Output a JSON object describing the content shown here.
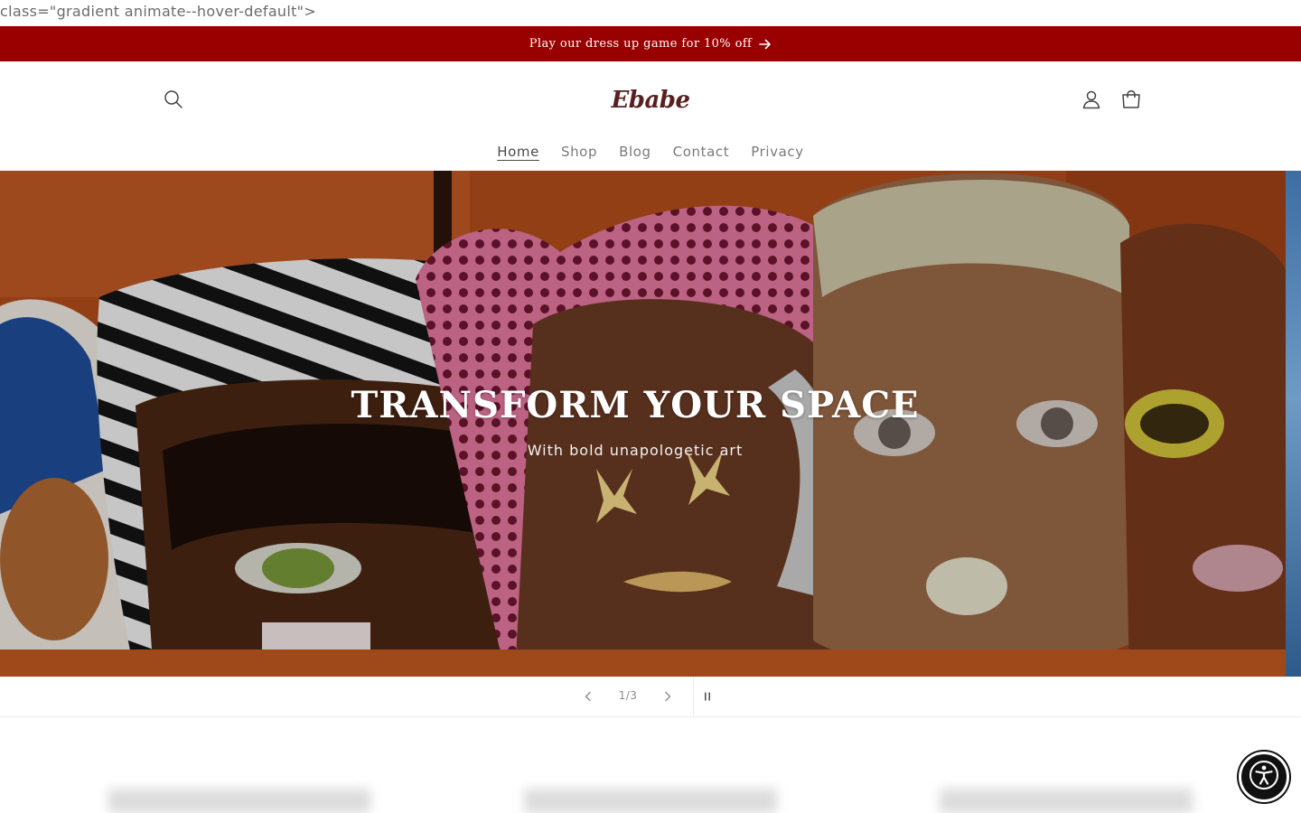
{
  "stray_text": "class=\"gradient animate--hover-default\">",
  "announcement": {
    "text": "Play our dress up game for 10% off",
    "bg_color": "#990000",
    "arrow_icon": "arrow-right-icon"
  },
  "header": {
    "logo_text": "Ebabe",
    "icons": {
      "search": "search-icon",
      "account": "account-icon",
      "cart": "cart-icon"
    }
  },
  "nav": {
    "items": [
      {
        "label": "Home",
        "active": true
      },
      {
        "label": "Shop",
        "active": false
      },
      {
        "label": "Blog",
        "active": false
      },
      {
        "label": "Contact",
        "active": false
      },
      {
        "label": "Privacy",
        "active": false
      }
    ]
  },
  "hero": {
    "title": "TRANSFORM YOUR SPACE",
    "subtitle": "With bold unapologetic art",
    "accent_color": "#b8501e"
  },
  "slider": {
    "counter": "1/3",
    "current": 1,
    "total": 3,
    "prev_icon": "chevron-left-icon",
    "next_icon": "chevron-right-icon",
    "pause_icon": "pause-icon"
  },
  "accessibility": {
    "icon": "accessibility-icon"
  }
}
